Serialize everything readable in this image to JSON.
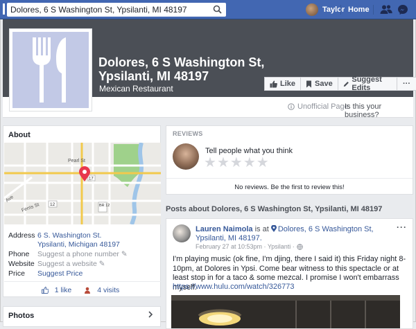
{
  "topbar": {
    "search_value": "Dolores, 6 S Washington St, Ypsilanti, MI 48197",
    "user_name": "Taylor",
    "home_label": "Home"
  },
  "page": {
    "title": "Dolores, 6 S Washington St, Ypsilanti, MI 48197",
    "category": "Mexican Restaurant",
    "actions": {
      "like": "Like",
      "save": "Save",
      "suggest_edits": "Suggest Edits",
      "more": "···"
    },
    "unofficial_label": "Unofficial Page",
    "business_prompt": "Is this your business?"
  },
  "about": {
    "heading": "About",
    "map_labels": {
      "street": "Pearl St",
      "ave": "Ave",
      "ferris": "Ferris St",
      "route_12": "12",
      "route_br12": "BR 12",
      "route_17": "17"
    },
    "address_label": "Address",
    "address_line1": "6 S. Washington St.",
    "address_line2": "Ypsilanti, Michigan 48197",
    "phone_label": "Phone",
    "phone_value": "Suggest a phone number",
    "website_label": "Website",
    "website_value": "Suggest a website",
    "price_label": "Price",
    "price_value": "Suggest Price",
    "likes": "1 like",
    "visits": "4 visits"
  },
  "photos": {
    "heading": "Photos"
  },
  "reviews": {
    "heading": "REVIEWS",
    "prompt": "Tell people what you think",
    "empty": "No reviews. Be the first to review this!"
  },
  "posts": {
    "heading": "Posts about Dolores, 6 S Washington St, Ypsilanti, MI 48197",
    "post": {
      "author": "Lauren Naimola",
      "is_at": " is at ",
      "place": "Dolores, 6 S Washington St, Ypsilanti, MI 48197.",
      "meta": "February 27 at 10:53pm · Ypsilanti ·",
      "body": "I'm playing music (ok fine, I'm djing, there I said it) this Friday night 8-10pm, at Dolores in Ypsi. Come bear witness to this spectacle or at least stop in for a taco & some mezcal. I promise I won't embarrass myself.",
      "link": "https://www.hulu.com/watch/326773",
      "more": "···"
    }
  },
  "colors": {
    "topbar": "#4267b2",
    "cover": "#4b4f56",
    "link": "#365899",
    "map_park": "#9fd18b",
    "map_river": "#9fc5e8",
    "pin": "#e8374c"
  }
}
